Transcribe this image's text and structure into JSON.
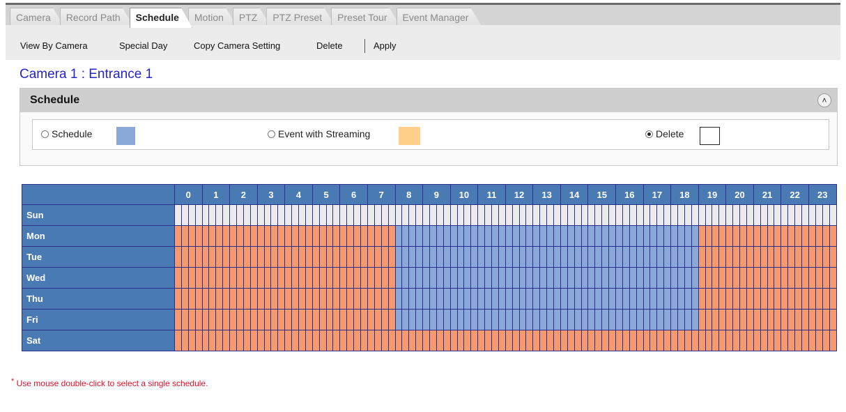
{
  "tabs": [
    "Camera",
    "Record Path",
    "Schedule",
    "Motion",
    "PTZ",
    "PTZ Preset",
    "Preset Tour",
    "Event Manager"
  ],
  "active_tab": "Schedule",
  "toolbar": {
    "view_by_camera": "View By Camera",
    "special_day": "Special Day",
    "copy_camera_setting": "Copy Camera Setting",
    "delete": "Delete",
    "apply": "Apply"
  },
  "camera_title": "Camera 1 : Entrance 1",
  "panel": {
    "title": "Schedule",
    "collapse_icon": "double-chevron-up-icon",
    "options": [
      {
        "label": "Schedule",
        "color": "#8aa8d8",
        "selected": false
      },
      {
        "label": "Event with Streaming",
        "color": "#ffd08a",
        "selected": false
      },
      {
        "label": "Delete",
        "color": "#ffffff",
        "selected": true
      }
    ]
  },
  "grid": {
    "hours": [
      "0",
      "1",
      "2",
      "3",
      "4",
      "5",
      "6",
      "7",
      "8",
      "9",
      "10",
      "11",
      "12",
      "13",
      "14",
      "15",
      "16",
      "17",
      "18",
      "19",
      "20",
      "21",
      "22",
      "23"
    ],
    "days": [
      "Sun",
      "Mon",
      "Tue",
      "Wed",
      "Thu",
      "Fri",
      "Sat"
    ],
    "colors": {
      "none": "#ececec",
      "schedule": "#8aa8d8",
      "event": "#f59a6e"
    },
    "subdivisions_per_hour": 4,
    "rows": {
      "Sun": {
        "event_hours": [],
        "schedule_hours": []
      },
      "Mon": {
        "event_hours": [
          0,
          1,
          2,
          3,
          4,
          5,
          6,
          7,
          19,
          20,
          21,
          22,
          23
        ],
        "schedule_hours": [
          8,
          9,
          10,
          11,
          12,
          13,
          14,
          15,
          16,
          17,
          18
        ]
      },
      "Tue": {
        "event_hours": [
          0,
          1,
          2,
          3,
          4,
          5,
          6,
          7,
          19,
          20,
          21,
          22,
          23
        ],
        "schedule_hours": [
          8,
          9,
          10,
          11,
          12,
          13,
          14,
          15,
          16,
          17,
          18
        ]
      },
      "Wed": {
        "event_hours": [
          0,
          1,
          2,
          3,
          4,
          5,
          6,
          7,
          19,
          20,
          21,
          22,
          23
        ],
        "schedule_hours": [
          8,
          9,
          10,
          11,
          12,
          13,
          14,
          15,
          16,
          17,
          18
        ]
      },
      "Thu": {
        "event_hours": [
          0,
          1,
          2,
          3,
          4,
          5,
          6,
          7,
          19,
          20,
          21,
          22,
          23
        ],
        "schedule_hours": [
          8,
          9,
          10,
          11,
          12,
          13,
          14,
          15,
          16,
          17,
          18
        ]
      },
      "Fri": {
        "event_hours": [
          0,
          1,
          2,
          3,
          4,
          5,
          6,
          7,
          19,
          20,
          21,
          22,
          23
        ],
        "schedule_hours": [
          8,
          9,
          10,
          11,
          12,
          13,
          14,
          15,
          16,
          17,
          18
        ]
      },
      "Sat": {
        "event_hours": [
          0,
          1,
          2,
          3,
          4,
          5,
          6,
          7,
          8,
          9,
          10,
          11,
          12,
          13,
          14,
          15,
          16,
          17,
          18,
          19,
          20,
          21,
          22,
          23
        ],
        "schedule_hours": []
      }
    }
  },
  "note": {
    "star": "*",
    "text": " Use mouse double-click to select a single schedule."
  }
}
